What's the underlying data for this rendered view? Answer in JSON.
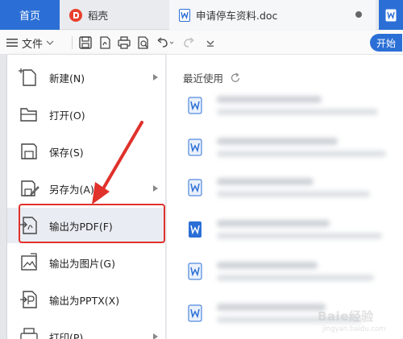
{
  "tabs": {
    "home": "首页",
    "daoke": "稻壳",
    "doc": "申请停车资料.doc"
  },
  "toolbar": {
    "file_label": "文件",
    "start_label": "开始"
  },
  "menu": {
    "items": [
      {
        "label": "新建(N)",
        "icon": "new-file-icon",
        "submenu": true
      },
      {
        "label": "打开(O)",
        "icon": "folder-open-icon",
        "submenu": false
      },
      {
        "label": "保存(S)",
        "icon": "save-icon",
        "submenu": false
      },
      {
        "label": "另存为(A)",
        "icon": "save-as-icon",
        "submenu": true
      },
      {
        "label": "输出为PDF(F)",
        "icon": "export-pdf-icon",
        "submenu": false
      },
      {
        "label": "输出为图片(G)",
        "icon": "export-image-icon",
        "submenu": false
      },
      {
        "label": "输出为PPTX(X)",
        "icon": "export-pptx-icon",
        "submenu": false
      },
      {
        "label": "打印(P)",
        "icon": "print-icon",
        "submenu": true
      }
    ]
  },
  "recent": {
    "title": "最近使用"
  },
  "watermark": {
    "top": "Baie经验",
    "bottom": "jingyan.baidu.com"
  },
  "colors": {
    "accent": "#2b6fd6",
    "highlight": "#e0312b",
    "wps_doc": "#2b6fd6"
  }
}
